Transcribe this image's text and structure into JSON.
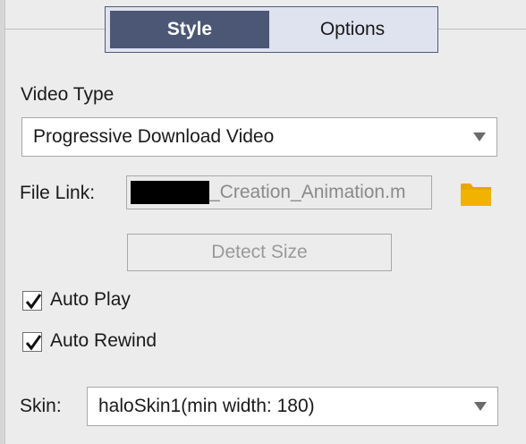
{
  "tabs": {
    "style_label": "Style",
    "options_label": "Options",
    "active": "Style"
  },
  "video_type": {
    "label": "Video Type",
    "selected": "Progressive Download Video"
  },
  "file_link": {
    "label": "File Link:",
    "value_visible": "_Creation_Animation.m"
  },
  "detect_size": {
    "label": "Detect Size",
    "enabled": false
  },
  "options": {
    "auto_play": {
      "label": "Auto Play",
      "checked": true
    },
    "auto_rewind": {
      "label": "Auto Rewind",
      "checked": true
    }
  },
  "skin": {
    "label": "Skin:",
    "selected": "haloSkin1(min width: 180)"
  },
  "icons": {
    "folder": "folder-icon",
    "dropdown": "chevron-down-icon",
    "check": "checkmark-icon"
  },
  "colors": {
    "active_tab": "#4b5774",
    "tab_strip": "#dfe3ef",
    "folder": "#e8a600"
  }
}
